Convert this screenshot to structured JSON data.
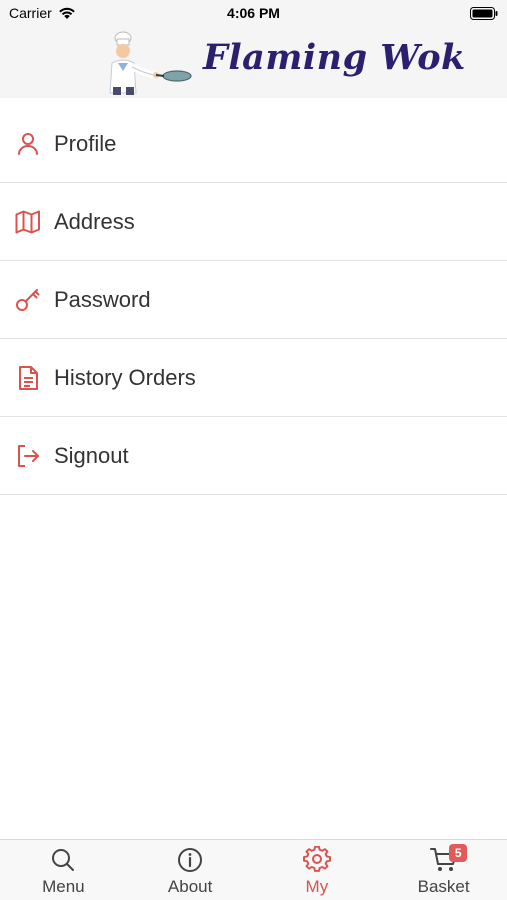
{
  "status_bar": {
    "carrier": "Carrier",
    "time": "4:06 PM"
  },
  "header": {
    "brand": "Flaming Wok"
  },
  "menu": {
    "items": [
      {
        "label": "Profile",
        "icon": "person-icon"
      },
      {
        "label": "Address",
        "icon": "map-icon"
      },
      {
        "label": "Password",
        "icon": "key-icon"
      },
      {
        "label": "History Orders",
        "icon": "document-icon"
      },
      {
        "label": "Signout",
        "icon": "signout-icon"
      }
    ]
  },
  "tab_bar": {
    "tabs": [
      {
        "label": "Menu",
        "icon": "search-icon"
      },
      {
        "label": "About",
        "icon": "info-icon"
      },
      {
        "label": "My",
        "icon": "gear-icon",
        "active": true
      },
      {
        "label": "Basket",
        "icon": "cart-icon",
        "badge": "5"
      }
    ]
  },
  "colors": {
    "accent": "#d9534f",
    "brand": "#2b2070",
    "badge": "#e35a5a"
  }
}
